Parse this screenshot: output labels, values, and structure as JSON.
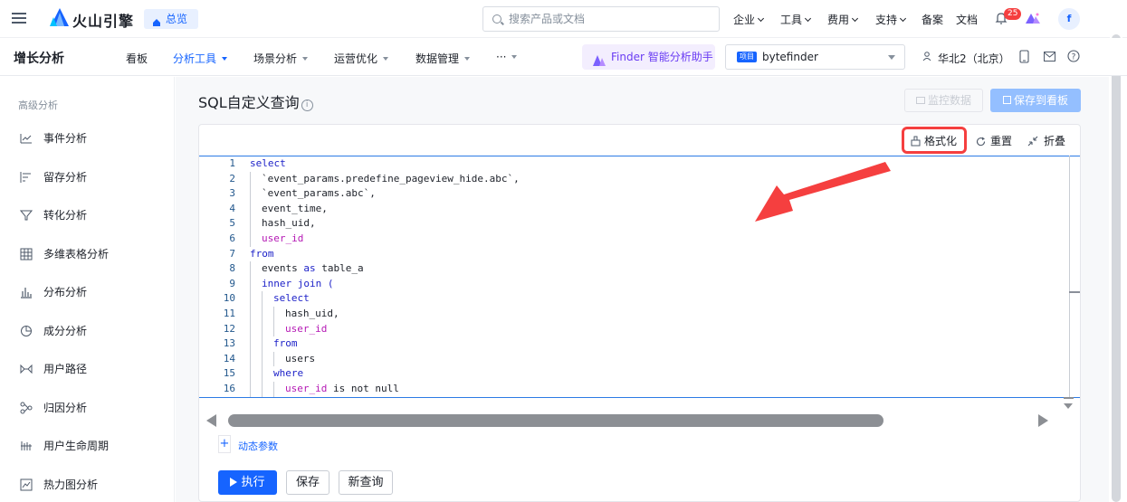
{
  "topbar": {
    "brand": "火山引擎",
    "overview_label": "总览",
    "search_placeholder": "搜索产品或文档",
    "nav": [
      "企业",
      "工具",
      "费用",
      "支持"
    ],
    "links": [
      "备案",
      "文档"
    ],
    "notification_count": "25",
    "avatar_initial": "f"
  },
  "subbar": {
    "app_title": "增长分析",
    "nav": [
      {
        "label": "看板"
      },
      {
        "label": "分析工具"
      },
      {
        "label": "场景分析"
      },
      {
        "label": "运营优化"
      },
      {
        "label": "数据管理"
      },
      {
        "label": "···"
      }
    ],
    "finder_label": "Finder 智能分析助手",
    "project_tag": "项目",
    "project_name": "bytefinder",
    "region": "华北2（北京）"
  },
  "sidebar": {
    "section_title": "高级分析",
    "items": [
      {
        "label": "事件分析",
        "icon": "line-chart-icon"
      },
      {
        "label": "留存分析",
        "icon": "retention-icon"
      },
      {
        "label": "转化分析",
        "icon": "funnel-icon"
      },
      {
        "label": "多维表格分析",
        "icon": "table-icon"
      },
      {
        "label": "分布分析",
        "icon": "bar-chart-icon"
      },
      {
        "label": "成分分析",
        "icon": "pie-chart-icon"
      },
      {
        "label": "用户路径",
        "icon": "path-icon"
      },
      {
        "label": "归因分析",
        "icon": "attribution-icon"
      },
      {
        "label": "用户生命周期",
        "icon": "lifecycle-icon"
      },
      {
        "label": "热力图分析",
        "icon": "heatmap-icon"
      }
    ]
  },
  "main": {
    "title": "SQL自定义查询",
    "monitor_button": "监控数据",
    "save_board_button": "保存到看板",
    "toolbar": {
      "format": "格式化",
      "reset": "重置",
      "fold": "折叠"
    },
    "dynamic_params": "动态参数",
    "run_button": "执行",
    "save_button": "保存",
    "new_query_button": "新查询"
  },
  "editor": {
    "lines": [
      {
        "n": "1",
        "indent": 0,
        "parts": [
          {
            "t": "select",
            "c": "kw"
          }
        ]
      },
      {
        "n": "2",
        "indent": 1,
        "parts": [
          {
            "t": "`event_params.predefine_pageview_hide.abc`,",
            "c": ""
          }
        ]
      },
      {
        "n": "3",
        "indent": 1,
        "parts": [
          {
            "t": "`event_params.abc`,",
            "c": ""
          }
        ]
      },
      {
        "n": "4",
        "indent": 1,
        "parts": [
          {
            "t": "event_time,",
            "c": ""
          }
        ]
      },
      {
        "n": "5",
        "indent": 1,
        "parts": [
          {
            "t": "hash_uid,",
            "c": ""
          }
        ]
      },
      {
        "n": "6",
        "indent": 1,
        "parts": [
          {
            "t": "user_id",
            "c": "fn"
          }
        ]
      },
      {
        "n": "7",
        "indent": 0,
        "parts": [
          {
            "t": "from",
            "c": "kw"
          }
        ]
      },
      {
        "n": "8",
        "indent": 1,
        "parts": [
          {
            "t": "events ",
            "c": ""
          },
          {
            "t": "as",
            "c": "kw"
          },
          {
            "t": " table_a",
            "c": ""
          }
        ]
      },
      {
        "n": "9",
        "indent": 1,
        "parts": [
          {
            "t": "inner join (",
            "c": "kw"
          }
        ]
      },
      {
        "n": "10",
        "indent": 2,
        "parts": [
          {
            "t": "select",
            "c": "kw"
          }
        ]
      },
      {
        "n": "11",
        "indent": 3,
        "parts": [
          {
            "t": "hash_uid,",
            "c": ""
          }
        ]
      },
      {
        "n": "12",
        "indent": 3,
        "parts": [
          {
            "t": "user_id",
            "c": "fn"
          }
        ]
      },
      {
        "n": "13",
        "indent": 2,
        "parts": [
          {
            "t": "from",
            "c": "kw"
          }
        ]
      },
      {
        "n": "14",
        "indent": 3,
        "parts": [
          {
            "t": "users",
            "c": ""
          }
        ]
      },
      {
        "n": "15",
        "indent": 2,
        "parts": [
          {
            "t": "where",
            "c": "kw"
          }
        ]
      },
      {
        "n": "16",
        "indent": 3,
        "parts": [
          {
            "t": "user_id",
            "c": "fn"
          },
          {
            "t": " is not null",
            "c": ""
          }
        ]
      }
    ]
  },
  "colors": {
    "accent": "#1664ff",
    "highlight_red": "#f53f3f",
    "keyword": "#1e22c8",
    "identifier": "#b51ab5"
  }
}
